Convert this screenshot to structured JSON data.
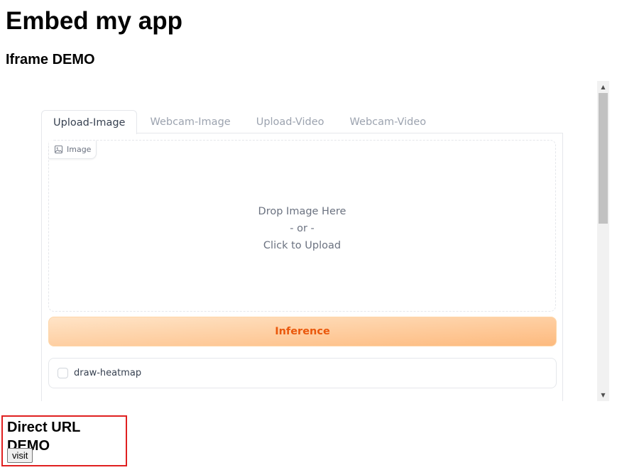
{
  "page": {
    "title": "Embed my app",
    "iframe_heading": "Iframe DEMO",
    "direct_heading": "Direct URL DEMO",
    "visit_label": "visit"
  },
  "app": {
    "tabs": [
      "Upload-Image",
      "Webcam-Image",
      "Upload-Video",
      "Webcam-Video"
    ],
    "active_tab": "Upload-Image",
    "image_label": "Image",
    "drop_line1": "Drop Image Here",
    "drop_line2": "- or -",
    "drop_line3": "Click to Upload",
    "inference_label": "Inference",
    "checkbox_label": "draw-heatmap",
    "checkbox_checked": false
  },
  "colors": {
    "accent": "#ea580c",
    "highlight_border": "#e02020"
  },
  "icons": {
    "image_icon": "image-icon",
    "scroll_up": "scroll-up-arrow-icon",
    "scroll_down": "scroll-down-arrow-icon"
  }
}
